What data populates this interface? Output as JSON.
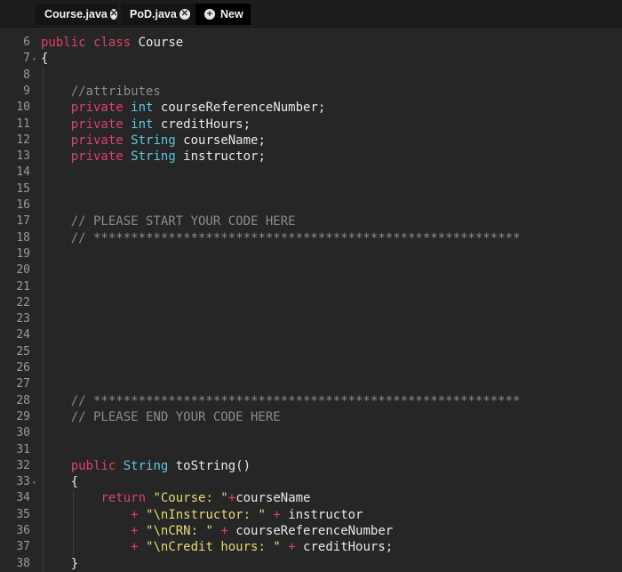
{
  "tabs": [
    {
      "label": "Course.java"
    },
    {
      "label": "PoD.java"
    },
    {
      "label": "New"
    }
  ],
  "lines": [
    {
      "n": "6",
      "text": "public class Course"
    },
    {
      "n": "7",
      "text": "{"
    },
    {
      "n": "8",
      "text": ""
    },
    {
      "n": "9",
      "text": "    //attributes"
    },
    {
      "n": "10",
      "text": "    private int courseReferenceNumber;"
    },
    {
      "n": "11",
      "text": "    private int creditHours;"
    },
    {
      "n": "12",
      "text": "    private String courseName;"
    },
    {
      "n": "13",
      "text": "    private String instructor;"
    },
    {
      "n": "14",
      "text": ""
    },
    {
      "n": "15",
      "text": ""
    },
    {
      "n": "16",
      "text": ""
    },
    {
      "n": "17",
      "text": "    // PLEASE START YOUR CODE HERE"
    },
    {
      "n": "18",
      "text": "    // *********************************************************"
    },
    {
      "n": "19",
      "text": ""
    },
    {
      "n": "20",
      "text": ""
    },
    {
      "n": "21",
      "text": ""
    },
    {
      "n": "22",
      "text": ""
    },
    {
      "n": "23",
      "text": ""
    },
    {
      "n": "24",
      "text": ""
    },
    {
      "n": "25",
      "text": ""
    },
    {
      "n": "26",
      "text": ""
    },
    {
      "n": "27",
      "text": ""
    },
    {
      "n": "28",
      "text": "    // *********************************************************"
    },
    {
      "n": "29",
      "text": "    // PLEASE END YOUR CODE HERE"
    },
    {
      "n": "30",
      "text": ""
    },
    {
      "n": "31",
      "text": ""
    },
    {
      "n": "32",
      "text": "    public String toString()"
    },
    {
      "n": "33",
      "text": "    {"
    },
    {
      "n": "34",
      "text": "        return \"Course: \"+courseName"
    },
    {
      "n": "35",
      "text": "            + \"\\nInstructor: \" + instructor"
    },
    {
      "n": "36",
      "text": "            + \"\\nCRN: \" + courseReferenceNumber"
    },
    {
      "n": "37",
      "text": "            + \"\\nCredit hours: \" + creditHours;"
    },
    {
      "n": "38",
      "text": "    }"
    }
  ],
  "colors": {
    "keyword": "#e0416a",
    "type": "#5cc8e8",
    "comment": "#8c8c8c",
    "string": "#e6db74",
    "background": "#262626"
  }
}
